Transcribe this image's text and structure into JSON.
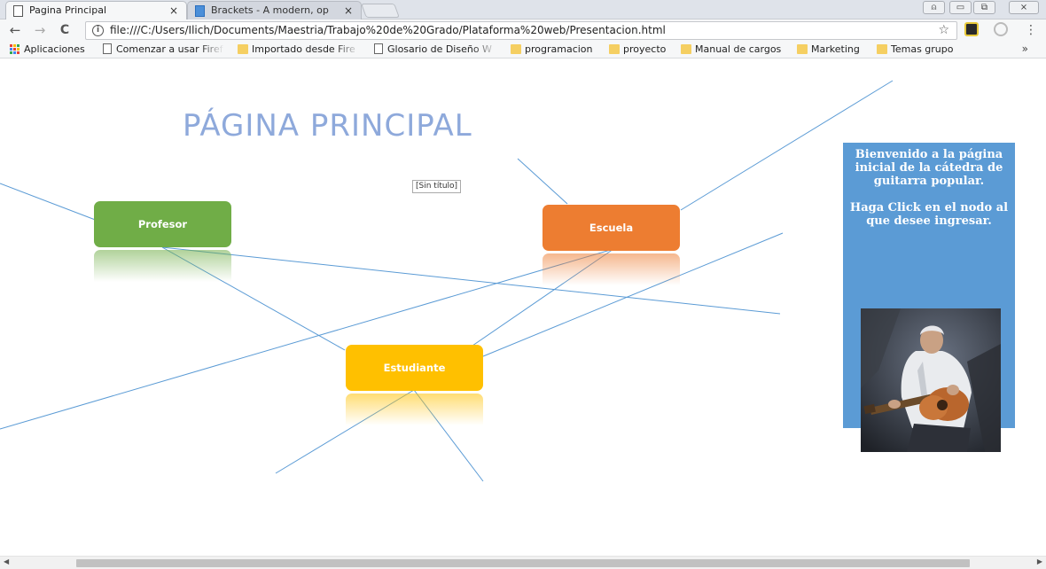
{
  "browser": {
    "tabs": [
      {
        "title": "Pagina Principal",
        "close": "×"
      },
      {
        "title": "Brackets - A modern, op",
        "close": "×"
      }
    ],
    "address": "file:///C:/Users/Ilich/Documents/Maestria/Trabajo%20de%20Grado/Plataforma%20web/Presentacion.html",
    "nav": {
      "back": "←",
      "forward": "→",
      "reload": "C"
    },
    "bookmarks": [
      {
        "label": "Aplicaciones",
        "icon": "apps-icon"
      },
      {
        "label": "Comenzar a usar Firef",
        "icon": "page-icon"
      },
      {
        "label": "Importado desde Fire",
        "icon": "folder-icon"
      },
      {
        "label": "Glosario de Diseño W",
        "icon": "page-icon"
      },
      {
        "label": "programacion",
        "icon": "folder-icon"
      },
      {
        "label": "proyecto",
        "icon": "folder-icon"
      },
      {
        "label": "Manual de cargos",
        "icon": "folder-icon"
      },
      {
        "label": "Marketing",
        "icon": "folder-icon"
      },
      {
        "label": "Temas grupo",
        "icon": "folder-icon"
      }
    ],
    "overflow": "»"
  },
  "page": {
    "title": "PÁGINA PRINCIPAL",
    "untitled_tag": "[Sin título]",
    "nodes": {
      "profesor": "Profesor",
      "escuela": "Escuela",
      "estudiante": "Estudiante"
    },
    "welcome": {
      "line1": "Bienvenido a la página inicial de la cátedra de guitarra popular.",
      "line2": "Haga Click en el nodo al que desee ingresar."
    }
  },
  "colors": {
    "title": "#8ea9db",
    "lines": "#5b9bd5",
    "profesor": "#70ad47",
    "escuela": "#ed7d31",
    "estudiante": "#ffc000",
    "panel": "#5b9bd5"
  }
}
